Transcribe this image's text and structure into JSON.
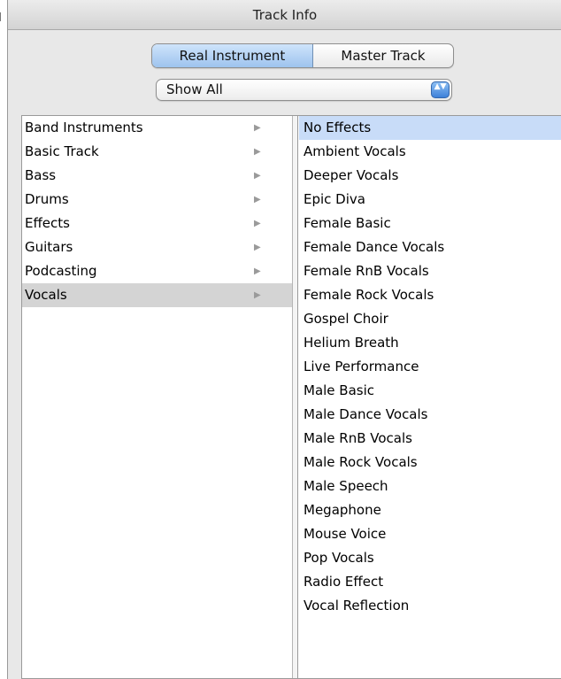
{
  "window": {
    "title": "Track Info"
  },
  "segmented": {
    "active": "Real Instrument",
    "inactive": "Master Track"
  },
  "popup": {
    "value": "Show All",
    "stepper_glyph": "▲▼"
  },
  "categories": [
    {
      "label": "Band Instruments",
      "selected": false
    },
    {
      "label": "Basic Track",
      "selected": false
    },
    {
      "label": "Bass",
      "selected": false
    },
    {
      "label": "Drums",
      "selected": false
    },
    {
      "label": "Effects",
      "selected": false
    },
    {
      "label": "Guitars",
      "selected": false
    },
    {
      "label": "Podcasting",
      "selected": false
    },
    {
      "label": "Vocals",
      "selected": true
    }
  ],
  "presets": [
    {
      "label": "No Effects",
      "selected": true
    },
    {
      "label": "Ambient Vocals",
      "selected": false
    },
    {
      "label": "Deeper Vocals",
      "selected": false
    },
    {
      "label": "Epic Diva",
      "selected": false
    },
    {
      "label": "Female Basic",
      "selected": false
    },
    {
      "label": "Female Dance Vocals",
      "selected": false
    },
    {
      "label": "Female RnB Vocals",
      "selected": false
    },
    {
      "label": "Female Rock Vocals",
      "selected": false
    },
    {
      "label": "Gospel Choir",
      "selected": false
    },
    {
      "label": "Helium Breath",
      "selected": false
    },
    {
      "label": "Live Performance",
      "selected": false
    },
    {
      "label": "Male Basic",
      "selected": false
    },
    {
      "label": "Male Dance Vocals",
      "selected": false
    },
    {
      "label": "Male RnB Vocals",
      "selected": false
    },
    {
      "label": "Male Rock Vocals",
      "selected": false
    },
    {
      "label": "Male Speech",
      "selected": false
    },
    {
      "label": "Megaphone",
      "selected": false
    },
    {
      "label": "Mouse Voice",
      "selected": false
    },
    {
      "label": "Pop Vocals",
      "selected": false
    },
    {
      "label": "Radio Effect",
      "selected": false
    },
    {
      "label": "Vocal Reflection",
      "selected": false
    }
  ],
  "icons": {
    "submenu_arrow": "▶"
  }
}
